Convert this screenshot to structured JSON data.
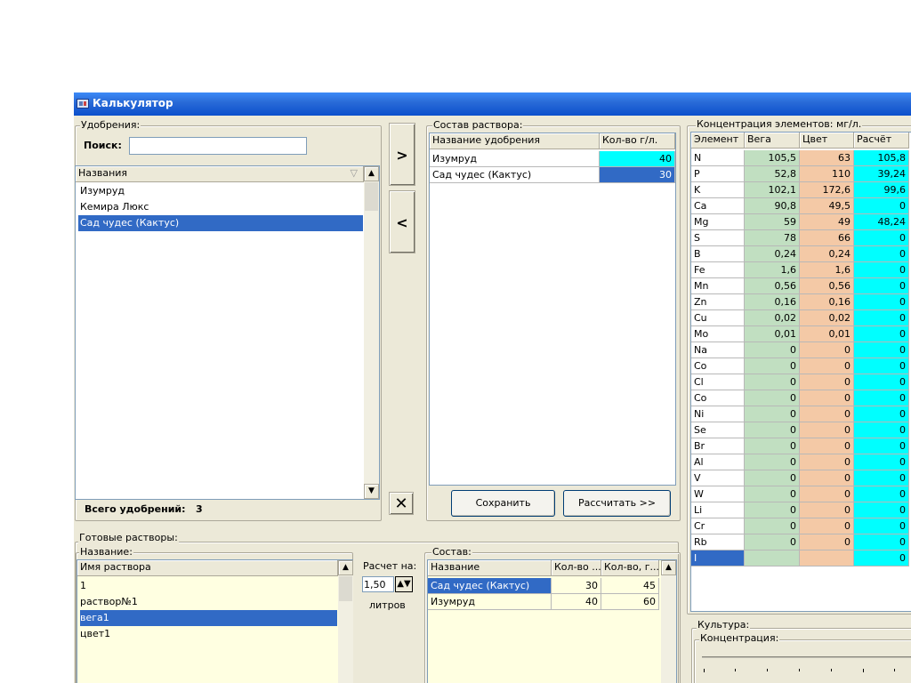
{
  "window": {
    "title": "Калькулятор"
  },
  "fertilizers": {
    "group_label": "Удобрения:",
    "search_label": "Поиск:",
    "search_value": "",
    "column_header": "Названия",
    "items": [
      "Изумруд",
      "Кемира Люкс",
      "Сад чудес (Кактус)"
    ],
    "selected_index": 2,
    "total_label": "Всего удобрений:",
    "total_value": "3"
  },
  "transfer_buttons": {
    "add": ">",
    "remove": "<",
    "clear": "✕"
  },
  "solution": {
    "group_label": "Состав раствора:",
    "headers": [
      "Название удобрения",
      "Кол-во г/л."
    ],
    "rows": [
      {
        "name": "Изумруд",
        "qty": "40"
      },
      {
        "name": "Сад чудес (Кактус)",
        "qty": "30"
      }
    ],
    "save_button": "Сохранить",
    "calc_button": "Рассчитать >>"
  },
  "concentration": {
    "group_label": "Концентрация элементов: мг/л.",
    "headers": [
      "Элемент",
      "Вега",
      "Цвет",
      "Расчёт"
    ],
    "rows": [
      [
        "N",
        "105,5",
        "63",
        "105,8"
      ],
      [
        "P",
        "52,8",
        "110",
        "39,24"
      ],
      [
        "K",
        "102,1",
        "172,6",
        "99,6"
      ],
      [
        "Ca",
        "90,8",
        "49,5",
        "0"
      ],
      [
        "Mg",
        "59",
        "49",
        "48,24"
      ],
      [
        "S",
        "78",
        "66",
        "0"
      ],
      [
        "B",
        "0,24",
        "0,24",
        "0"
      ],
      [
        "Fe",
        "1,6",
        "1,6",
        "0"
      ],
      [
        "Mn",
        "0,56",
        "0,56",
        "0"
      ],
      [
        "Zn",
        "0,16",
        "0,16",
        "0"
      ],
      [
        "Cu",
        "0,02",
        "0,02",
        "0"
      ],
      [
        "Mo",
        "0,01",
        "0,01",
        "0"
      ],
      [
        "Na",
        "0",
        "0",
        "0"
      ],
      [
        "Co",
        "0",
        "0",
        "0"
      ],
      [
        "Cl",
        "0",
        "0",
        "0"
      ],
      [
        "Co",
        "0",
        "0",
        "0"
      ],
      [
        "Ni",
        "0",
        "0",
        "0"
      ],
      [
        "Se",
        "0",
        "0",
        "0"
      ],
      [
        "Br",
        "0",
        "0",
        "0"
      ],
      [
        "Al",
        "0",
        "0",
        "0"
      ],
      [
        "V",
        "0",
        "0",
        "0"
      ],
      [
        "W",
        "0",
        "0",
        "0"
      ],
      [
        "Li",
        "0",
        "0",
        "0"
      ],
      [
        "Cr",
        "0",
        "0",
        "0"
      ],
      [
        "Rb",
        "0",
        "0",
        "0"
      ],
      [
        "I",
        "",
        "",
        "0"
      ]
    ]
  },
  "ready_solutions": {
    "group_label": "Готовые растворы:",
    "name_label": "Название:",
    "column_header": "Имя раствора",
    "items": [
      "1",
      "раствор№1",
      "вега1",
      "цвет1"
    ],
    "selected_index": 2,
    "calc_for_label": "Расчет на:",
    "calc_for_value": "1,50",
    "unit_label": "литров"
  },
  "composition": {
    "group_label": "Состав:",
    "headers": [
      "Название",
      "Кол-во ...",
      "Кол-во, г..."
    ],
    "rows": [
      {
        "name": "Сад чудес (Кактус)",
        "q1": "30",
        "q2": "45"
      },
      {
        "name": "Изумруд",
        "q1": "40",
        "q2": "60"
      }
    ]
  },
  "culture": {
    "group_label": "Культура:",
    "concentration_label": "Концентрация:"
  }
}
